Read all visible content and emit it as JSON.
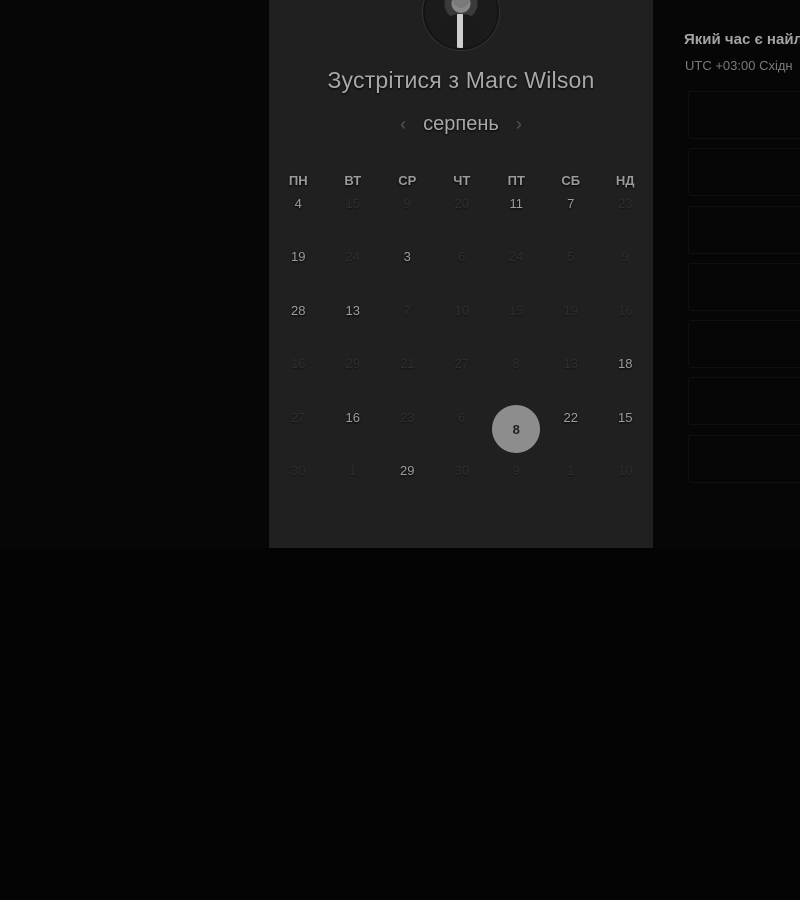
{
  "header": {
    "title": "Зустрітися з Marc Wilson"
  },
  "calendar": {
    "month": "серпень",
    "prev_icon": "chevron-left-icon",
    "next_icon": "chevron-right-icon",
    "weekdays": [
      "ПН",
      "ВТ",
      "СР",
      "ЧТ",
      "ПТ",
      "СБ",
      "НД"
    ],
    "rows": [
      [
        {
          "t": "4",
          "on": true
        },
        {
          "t": "15",
          "on": false
        },
        {
          "t": "9",
          "on": false
        },
        {
          "t": "20",
          "on": false
        },
        {
          "t": "11",
          "on": true
        },
        {
          "t": "7",
          "on": true
        },
        {
          "t": "23",
          "on": false
        }
      ],
      [
        {
          "t": "19",
          "on": true
        },
        {
          "t": "24",
          "on": false
        },
        {
          "t": "3",
          "on": true
        },
        {
          "t": "6",
          "on": false
        },
        {
          "t": "24",
          "on": false
        },
        {
          "t": "5",
          "on": false
        },
        {
          "t": "9",
          "on": false
        }
      ],
      [
        {
          "t": "28",
          "on": true
        },
        {
          "t": "13",
          "on": true
        },
        {
          "t": "7",
          "on": false
        },
        {
          "t": "10",
          "on": false
        },
        {
          "t": "15",
          "on": false
        },
        {
          "t": "19",
          "on": false
        },
        {
          "t": "16",
          "on": false
        }
      ],
      [
        {
          "t": "16",
          "on": false
        },
        {
          "t": "29",
          "on": false
        },
        {
          "t": "21",
          "on": false
        },
        {
          "t": "27",
          "on": false
        },
        {
          "t": "8",
          "on": false
        },
        {
          "t": "13",
          "on": false
        },
        {
          "t": "18",
          "on": true
        }
      ],
      [
        {
          "t": "27",
          "on": false
        },
        {
          "t": "16",
          "on": true
        },
        {
          "t": "23",
          "on": false
        },
        {
          "t": "6",
          "on": false
        },
        {
          "t": "8",
          "on": true,
          "selected": true
        },
        {
          "t": "22",
          "on": true
        },
        {
          "t": "15",
          "on": true
        }
      ],
      [
        {
          "t": "30",
          "on": false
        },
        {
          "t": "1",
          "on": false
        },
        {
          "t": "29",
          "on": true
        },
        {
          "t": "30",
          "on": false
        },
        {
          "t": "9",
          "on": false
        },
        {
          "t": "1",
          "on": false
        },
        {
          "t": "10",
          "on": false
        }
      ]
    ]
  },
  "right": {
    "title": "Який час є найл",
    "timezone": "UTC +03:00 Східн",
    "slot_count": 7
  },
  "colors": {
    "card": "#202020",
    "selected": "#8d8d8d",
    "background": "#050505"
  }
}
